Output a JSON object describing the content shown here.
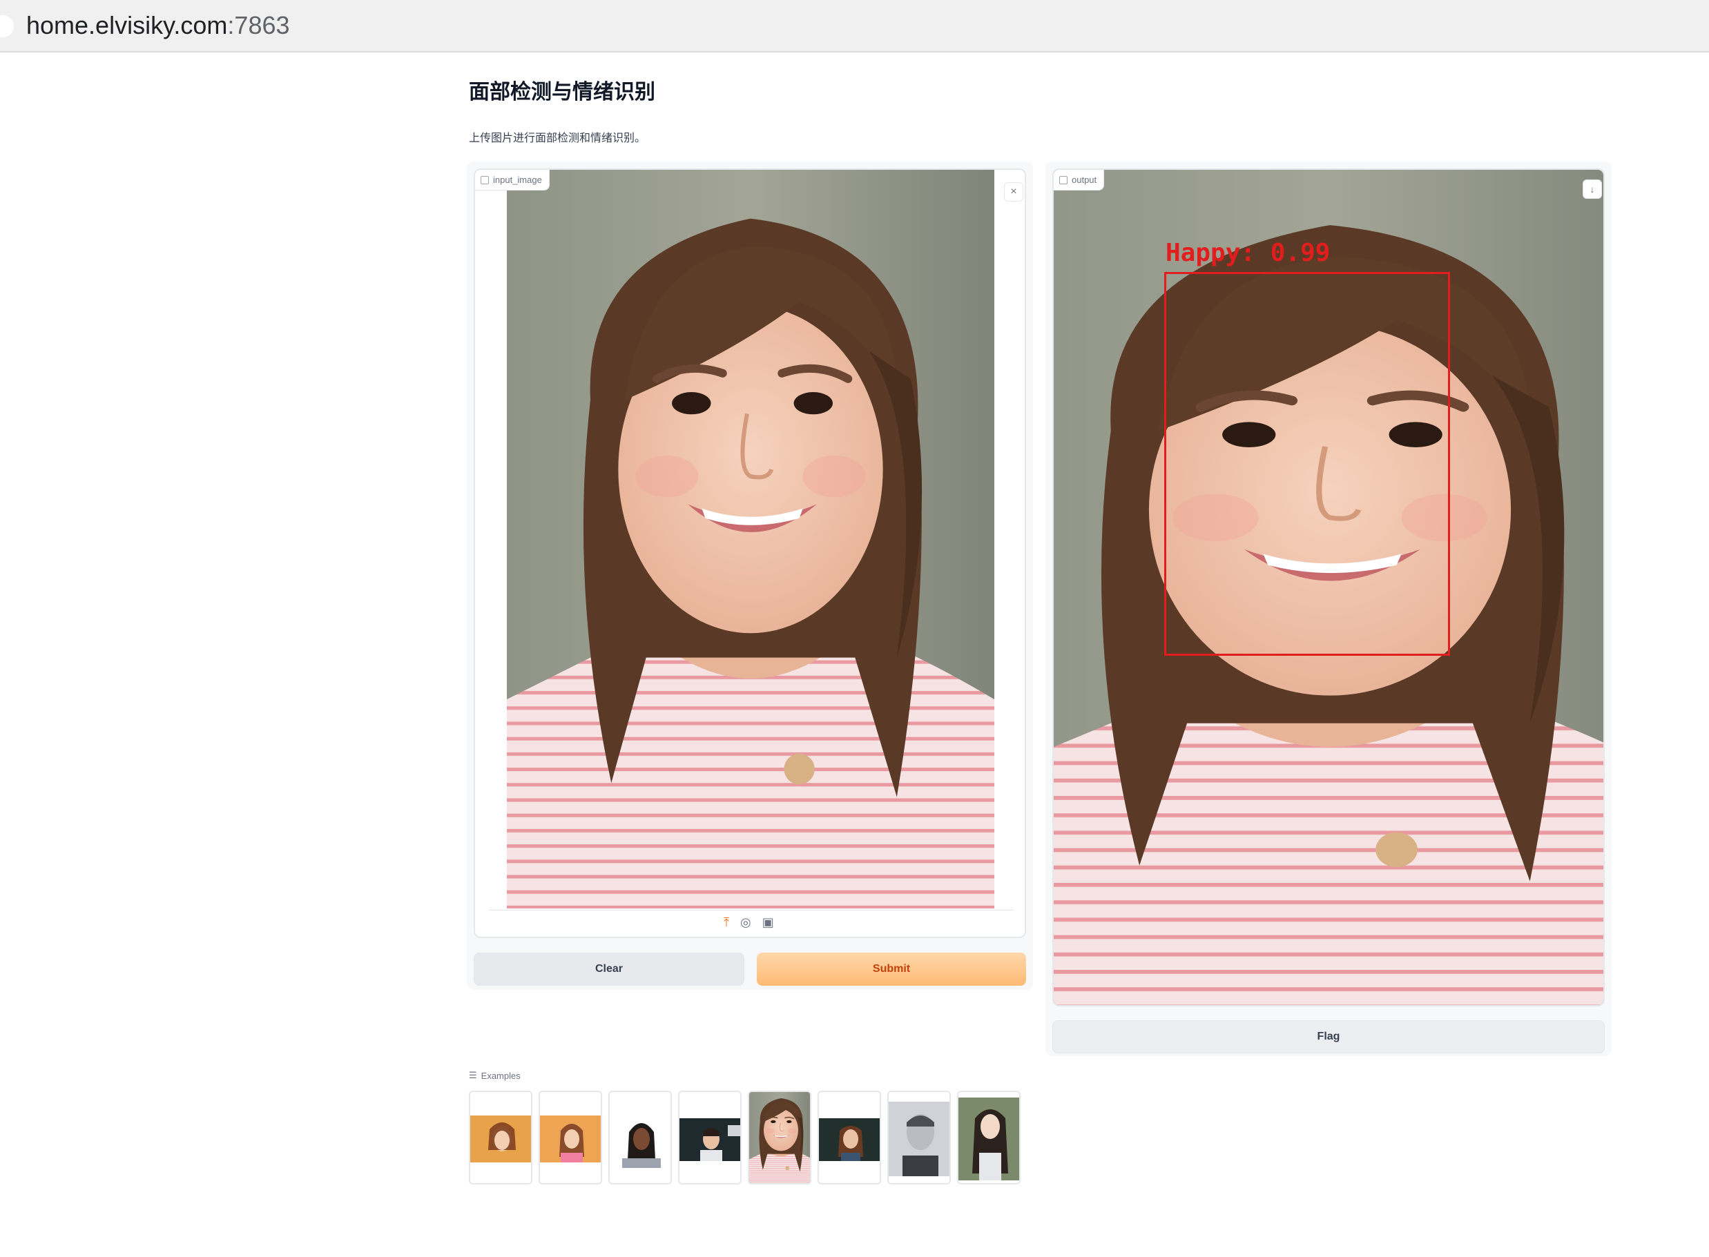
{
  "browser": {
    "url_host": "home.elvisiky.com",
    "url_port": ":7863"
  },
  "page": {
    "title": "面部检测与情绪识别",
    "description": "上传图片进行面部检测和情绪识别。"
  },
  "input": {
    "label": "input_image",
    "clear_icon": "close-icon",
    "sources": [
      "upload-icon",
      "webcam-icon",
      "clipboard-icon"
    ]
  },
  "output": {
    "label": "output",
    "download_icon": "download-icon",
    "detection": {
      "emotion_label": "Happy: 0.99"
    }
  },
  "buttons": {
    "clear": "Clear",
    "submit": "Submit",
    "flag": "Flag"
  },
  "examples": {
    "label": "Examples",
    "items": [
      {
        "name": "example-1",
        "bg": "#e7a24a"
      },
      {
        "name": "example-2",
        "bg": "#eea453"
      },
      {
        "name": "example-3",
        "bg": "#ffffff"
      },
      {
        "name": "example-4",
        "bg": "#1f2a2e"
      },
      {
        "name": "example-5",
        "bg": "#d9d3cb"
      },
      {
        "name": "example-6",
        "bg": "#21302c"
      },
      {
        "name": "example-7",
        "bg": "#9ca3af"
      },
      {
        "name": "example-8",
        "bg": "#6b7a5e"
      }
    ]
  },
  "colors": {
    "accent": "#f97316",
    "detection_box": "#e11d1d"
  }
}
